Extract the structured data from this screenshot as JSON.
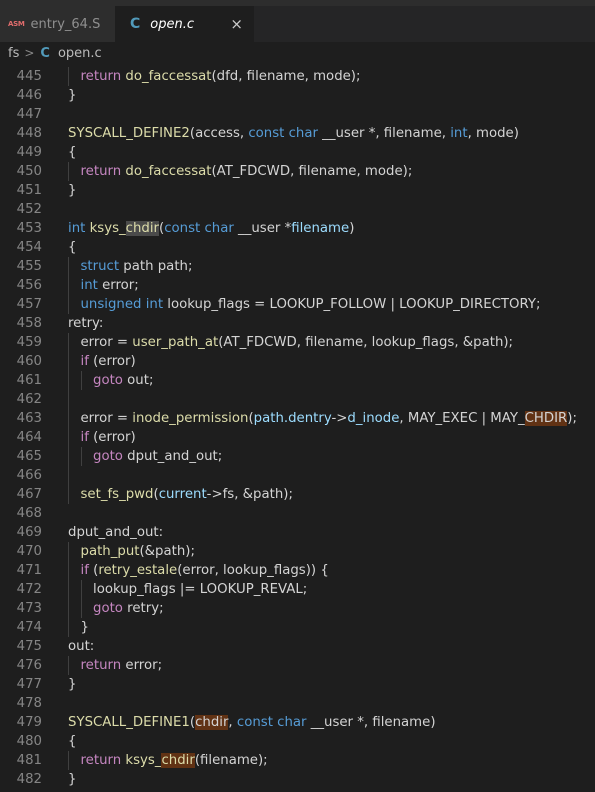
{
  "tabs": [
    {
      "icon": "ASM",
      "label": "entry_64.S"
    },
    {
      "icon": "C",
      "label": "open.c",
      "close": "×"
    }
  ],
  "breadcrumb": {
    "folder": "fs",
    "separator": ">",
    "icon": "C",
    "file": "open.c"
  },
  "colors": {
    "keyword": "#569cd6",
    "control": "#c586c0",
    "function": "#dcdcaa",
    "variable": "#9cdcfe",
    "text": "#d4d4d4",
    "line_number": "#858585",
    "background": "#1e1e1e"
  },
  "code_lines": [
    {
      "num": "445",
      "indent": 1,
      "tokens": [
        [
          "ctl",
          "return"
        ],
        [
          "t",
          " "
        ],
        [
          "fn",
          "do_faccessat"
        ],
        [
          "t",
          "(dfd, filename, mode);"
        ]
      ]
    },
    {
      "num": "446",
      "indent": 0,
      "tokens": [
        [
          "t",
          "}"
        ]
      ]
    },
    {
      "num": "447",
      "indent": 0,
      "tokens": []
    },
    {
      "num": "448",
      "indent": 0,
      "tokens": [
        [
          "fn",
          "SYSCALL_DEFINE2"
        ],
        [
          "t",
          "(access, "
        ],
        [
          "kw",
          "const"
        ],
        [
          "t",
          " "
        ],
        [
          "kw",
          "char"
        ],
        [
          "t",
          " __user *, filename, "
        ],
        [
          "kw",
          "int"
        ],
        [
          "t",
          ", mode)"
        ]
      ]
    },
    {
      "num": "449",
      "indent": 0,
      "tokens": [
        [
          "t",
          "{"
        ]
      ]
    },
    {
      "num": "450",
      "indent": 1,
      "tokens": [
        [
          "ctl",
          "return"
        ],
        [
          "t",
          " "
        ],
        [
          "fn",
          "do_faccessat"
        ],
        [
          "t",
          "(AT_FDCWD, filename, mode);"
        ]
      ]
    },
    {
      "num": "451",
      "indent": 0,
      "tokens": [
        [
          "t",
          "}"
        ]
      ]
    },
    {
      "num": "452",
      "indent": 0,
      "tokens": []
    },
    {
      "num": "453",
      "indent": 0,
      "tokens": [
        [
          "kw",
          "int"
        ],
        [
          "t",
          " "
        ],
        [
          "fn",
          "ksys_"
        ],
        [
          "fn hl",
          "chdir"
        ],
        [
          "t",
          "("
        ],
        [
          "kw",
          "const"
        ],
        [
          "t",
          " "
        ],
        [
          "kw",
          "char"
        ],
        [
          "t",
          " __user *"
        ],
        [
          "var",
          "filename"
        ],
        [
          "t",
          ")"
        ]
      ]
    },
    {
      "num": "454",
      "indent": 0,
      "tokens": [
        [
          "t",
          "{"
        ]
      ]
    },
    {
      "num": "455",
      "indent": 1,
      "tokens": [
        [
          "kw",
          "struct"
        ],
        [
          "t",
          " path path;"
        ]
      ]
    },
    {
      "num": "456",
      "indent": 1,
      "tokens": [
        [
          "kw",
          "int"
        ],
        [
          "t",
          " error;"
        ]
      ]
    },
    {
      "num": "457",
      "indent": 1,
      "tokens": [
        [
          "kw",
          "unsigned"
        ],
        [
          "t",
          " "
        ],
        [
          "kw",
          "int"
        ],
        [
          "t",
          " lookup_flags = LOOKUP_FOLLOW | LOOKUP_DIRECTORY;"
        ]
      ]
    },
    {
      "num": "458",
      "indent": 0,
      "tokens": [
        [
          "t",
          "retry:"
        ]
      ]
    },
    {
      "num": "459",
      "indent": 1,
      "tokens": [
        [
          "t",
          "error = "
        ],
        [
          "fn",
          "user_path_at"
        ],
        [
          "t",
          "(AT_FDCWD, filename, lookup_flags, &path);"
        ]
      ]
    },
    {
      "num": "460",
      "indent": 1,
      "tokens": [
        [
          "ctl",
          "if"
        ],
        [
          "t",
          " (error)"
        ]
      ]
    },
    {
      "num": "461",
      "indent": 2,
      "tokens": [
        [
          "ctl",
          "goto"
        ],
        [
          "t",
          " out;"
        ]
      ]
    },
    {
      "num": "462",
      "indent": 1,
      "tokens": []
    },
    {
      "num": "463",
      "indent": 1,
      "tokens": [
        [
          "t",
          "error = "
        ],
        [
          "fn",
          "inode_permission"
        ],
        [
          "t",
          "("
        ],
        [
          "var",
          "path.dentry"
        ],
        [
          "t",
          "->"
        ],
        [
          "var",
          "d_inode"
        ],
        [
          "t",
          ", MAY_EXEC | MAY_"
        ],
        [
          "t hlo",
          "CHDIR"
        ],
        [
          "t",
          ");"
        ]
      ]
    },
    {
      "num": "464",
      "indent": 1,
      "tokens": [
        [
          "ctl",
          "if"
        ],
        [
          "t",
          " (error)"
        ]
      ]
    },
    {
      "num": "465",
      "indent": 2,
      "tokens": [
        [
          "ctl",
          "goto"
        ],
        [
          "t",
          " dput_and_out;"
        ]
      ]
    },
    {
      "num": "466",
      "indent": 1,
      "tokens": []
    },
    {
      "num": "467",
      "indent": 1,
      "tokens": [
        [
          "fn",
          "set_fs_pwd"
        ],
        [
          "t",
          "("
        ],
        [
          "var",
          "current"
        ],
        [
          "t",
          "->fs, &path);"
        ]
      ]
    },
    {
      "num": "468",
      "indent": 0,
      "tokens": []
    },
    {
      "num": "469",
      "indent": 0,
      "tokens": [
        [
          "t",
          "dput_and_out:"
        ]
      ]
    },
    {
      "num": "470",
      "indent": 1,
      "tokens": [
        [
          "fn",
          "path_put"
        ],
        [
          "t",
          "(&path);"
        ]
      ]
    },
    {
      "num": "471",
      "indent": 1,
      "tokens": [
        [
          "ctl",
          "if"
        ],
        [
          "t",
          " ("
        ],
        [
          "fn",
          "retry_estale"
        ],
        [
          "t",
          "(error, lookup_flags)) {"
        ]
      ]
    },
    {
      "num": "472",
      "indent": 2,
      "tokens": [
        [
          "t",
          "lookup_flags |= LOOKUP_REVAL;"
        ]
      ]
    },
    {
      "num": "473",
      "indent": 2,
      "tokens": [
        [
          "ctl",
          "goto"
        ],
        [
          "t",
          " retry;"
        ]
      ]
    },
    {
      "num": "474",
      "indent": 1,
      "tokens": [
        [
          "t",
          "}"
        ]
      ]
    },
    {
      "num": "475",
      "indent": 0,
      "tokens": [
        [
          "t",
          "out:"
        ]
      ]
    },
    {
      "num": "476",
      "indent": 1,
      "tokens": [
        [
          "ctl",
          "return"
        ],
        [
          "t",
          " error;"
        ]
      ]
    },
    {
      "num": "477",
      "indent": 0,
      "tokens": [
        [
          "t",
          "}"
        ]
      ]
    },
    {
      "num": "478",
      "indent": 0,
      "tokens": []
    },
    {
      "num": "479",
      "indent": 0,
      "tokens": [
        [
          "fn",
          "SYSCALL_DEFINE1"
        ],
        [
          "t",
          "("
        ],
        [
          "t hlo",
          "chdir"
        ],
        [
          "t",
          ", "
        ],
        [
          "kw",
          "const"
        ],
        [
          "t",
          " "
        ],
        [
          "kw",
          "char"
        ],
        [
          "t",
          " __user *, filename)"
        ]
      ]
    },
    {
      "num": "480",
      "indent": 0,
      "tokens": [
        [
          "t",
          "{"
        ]
      ]
    },
    {
      "num": "481",
      "indent": 1,
      "tokens": [
        [
          "ctl",
          "return"
        ],
        [
          "t",
          " "
        ],
        [
          "fn",
          "ksys_"
        ],
        [
          "fn hlo",
          "chdir"
        ],
        [
          "t",
          "(filename);"
        ]
      ]
    },
    {
      "num": "482",
      "indent": 0,
      "tokens": [
        [
          "t",
          "}"
        ]
      ]
    }
  ]
}
